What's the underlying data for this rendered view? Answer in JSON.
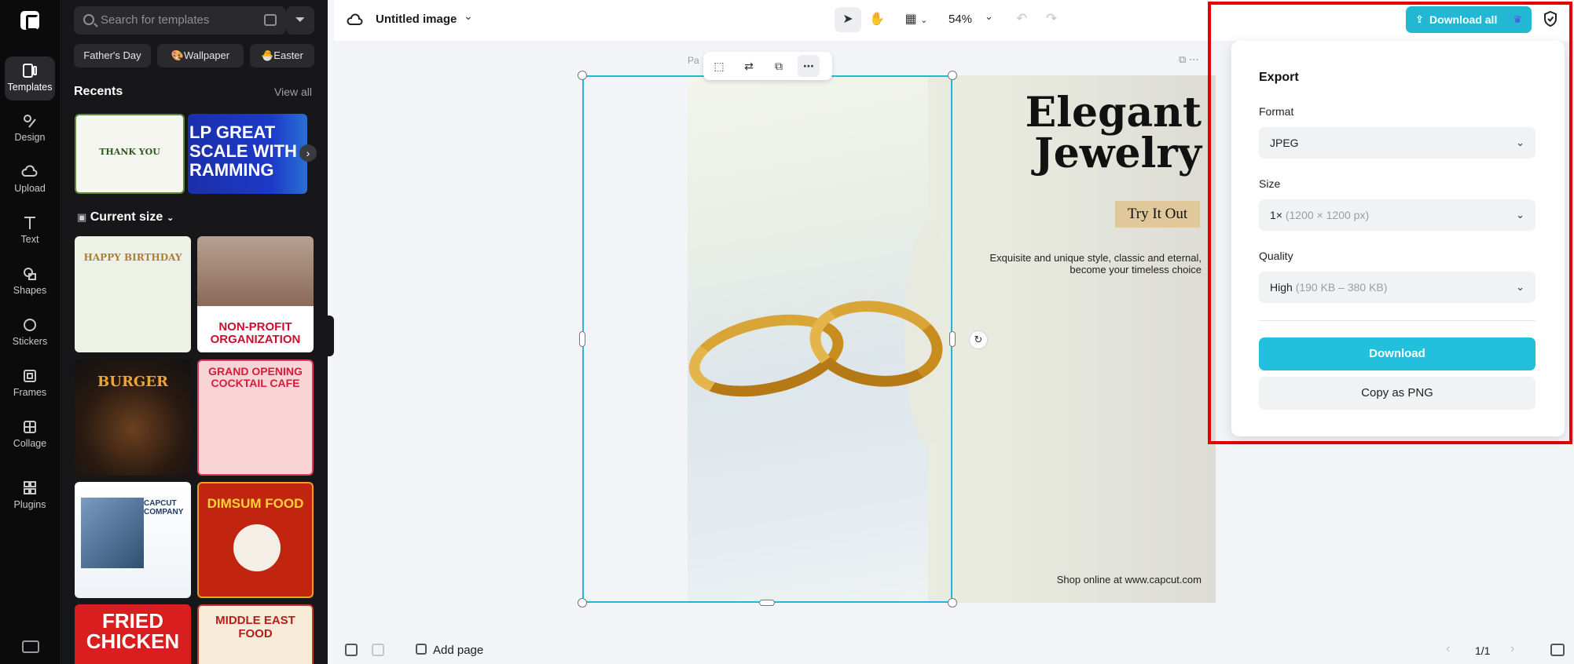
{
  "rail": {
    "items": [
      {
        "label": "Templates"
      },
      {
        "label": "Design"
      },
      {
        "label": "Upload"
      },
      {
        "label": "Text"
      },
      {
        "label": "Shapes"
      },
      {
        "label": "Stickers"
      },
      {
        "label": "Frames"
      },
      {
        "label": "Collage"
      },
      {
        "label": "Plugins"
      }
    ]
  },
  "panel": {
    "search_placeholder": "Search for templates",
    "chips": [
      "Father's Day",
      "🎨Wallpaper",
      "🐣Easter"
    ],
    "recents_title": "Recents",
    "view_all": "View all",
    "recent_thumbs": [
      {
        "text": "THANK YOU"
      },
      {
        "text": "LP GREAT SCALE WITH RAMMING"
      }
    ],
    "size_title": "Current size",
    "templates": [
      {
        "text": "HAPPY BIRTHDAY"
      },
      {
        "text": "NON-PROFIT ORGANIZATION"
      },
      {
        "text": "BURGER"
      },
      {
        "text": "GRAND OPENING COCKTAIL CAFE"
      },
      {
        "text": "CAPCUT COMPANY"
      },
      {
        "text": "DIMSUM FOOD"
      },
      {
        "text": "FRIED CHICKEN"
      },
      {
        "text": "MIDDLE EAST FOOD"
      }
    ]
  },
  "topbar": {
    "title": "Untitled image",
    "zoom": "54%"
  },
  "canvas": {
    "page_label": "Pa",
    "headline": "Elegant Jewelry",
    "cta": "Try It Out",
    "description": "Exquisite and unique style, classic and eternal, become your timeless choice",
    "shop": "Shop online at www.capcut.com"
  },
  "bottombar": {
    "add_page": "Add page",
    "pager": "1/1"
  },
  "export": {
    "download_all": "Download all",
    "title": "Export",
    "format_label": "Format",
    "format_value": "JPEG",
    "size_label": "Size",
    "size_value": "1×",
    "size_hint": "(1200 × 1200 px)",
    "quality_label": "Quality",
    "quality_value": "High",
    "quality_hint": "(190 KB – 380 KB)",
    "download": "Download",
    "copy_png": "Copy as PNG"
  },
  "colors": {
    "accent": "#22b8d4",
    "highlight": "#e60000"
  }
}
